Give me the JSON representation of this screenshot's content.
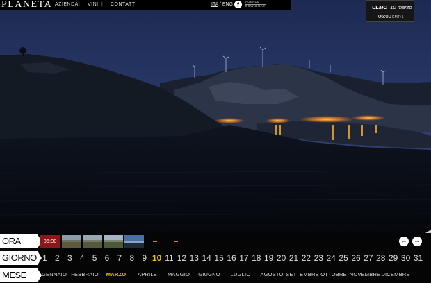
{
  "header": {
    "logo": "PLANETA",
    "nav": [
      "AZIENDA",
      "VINI",
      "CONTATTI"
    ],
    "lang_ita": "ITA",
    "lang_sep": " / ",
    "lang_eng": "ENG",
    "facebook_glyph": "f",
    "download_lines": [
      "AGENDE",
      "DOWNLOAD"
    ]
  },
  "webcam": {
    "location": "ULMO",
    "date": "10 marzo",
    "time": "06:00",
    "timezone": "GMT+1"
  },
  "ora": {
    "label": "ORA",
    "selected_time": "06:00",
    "arrow_prev": "←",
    "arrow_next": "→"
  },
  "giorno": {
    "label": "GIORNO",
    "days": [
      "1",
      "2",
      "3",
      "4",
      "5",
      "6",
      "7",
      "8",
      "9",
      "10",
      "11",
      "12",
      "13",
      "14",
      "15",
      "16",
      "17",
      "18",
      "19",
      "20",
      "21",
      "22",
      "23",
      "24",
      "25",
      "26",
      "27",
      "28",
      "29",
      "30",
      "31"
    ],
    "selected": "10"
  },
  "mese": {
    "label": "MESE",
    "months": [
      "GENNAIO",
      "FEBBRAIO",
      "MARZO",
      "APRILE",
      "MAGGIO",
      "GIUGNO",
      "LUGLIO",
      "AGOSTO",
      "SETTEMBRE",
      "OTTOBRE",
      "NOVEMBRE",
      "DICEMBRE"
    ],
    "selected": "MARZO"
  },
  "colors": {
    "accent": "#f2c200",
    "selected_thumb": "#8a1818"
  }
}
